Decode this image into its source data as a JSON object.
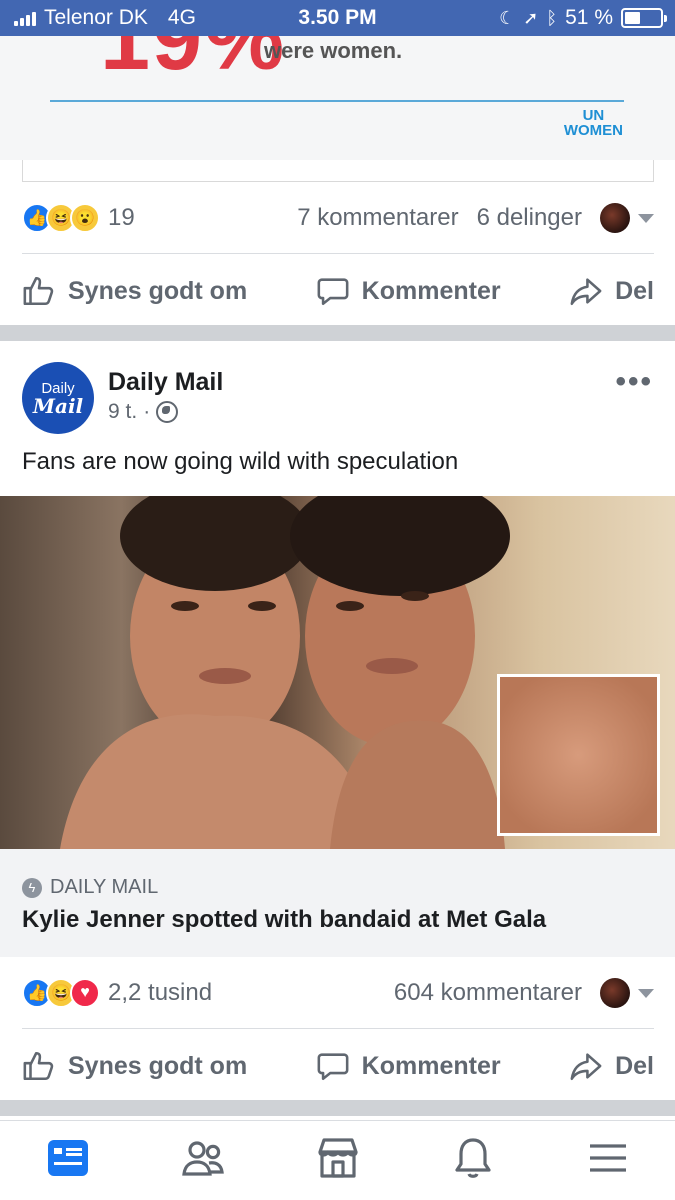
{
  "status_bar": {
    "carrier": "Telenor DK",
    "network": "4G",
    "time": "3.50 PM",
    "battery": "51 %",
    "battery_level_pct": 51
  },
  "prev_post": {
    "graphic_big_text": "19%",
    "graphic_text": "were women.",
    "logo_line1": "UN",
    "logo_line2": "WOMEN",
    "reactions": [
      "like",
      "haha",
      "wow"
    ],
    "reaction_count": "19",
    "comments": "7 kommentarer",
    "shares": "6 delinger"
  },
  "actions": {
    "like": "Synes godt om",
    "comment": "Kommenter",
    "share": "Del"
  },
  "post": {
    "page_name": "Daily Mail",
    "avatar_line1": "Daily",
    "avatar_line2": "Mail",
    "time": "9 t.",
    "dot": "·",
    "text": "Fans are now going wild with speculation",
    "more": "•••",
    "link_source": "DAILY MAIL",
    "link_title": "Kylie Jenner spotted with bandaid at Met Gala",
    "reactions": [
      "like",
      "haha",
      "love"
    ],
    "reaction_count": "2,2 tusind",
    "comments": "604 kommentarer"
  },
  "tabs": [
    "news-feed",
    "friends",
    "marketplace",
    "notifications",
    "menu"
  ],
  "colors": {
    "brand": "#4267b2",
    "accent_red": "#e03a45",
    "un_blue": "#1e8fd4"
  }
}
